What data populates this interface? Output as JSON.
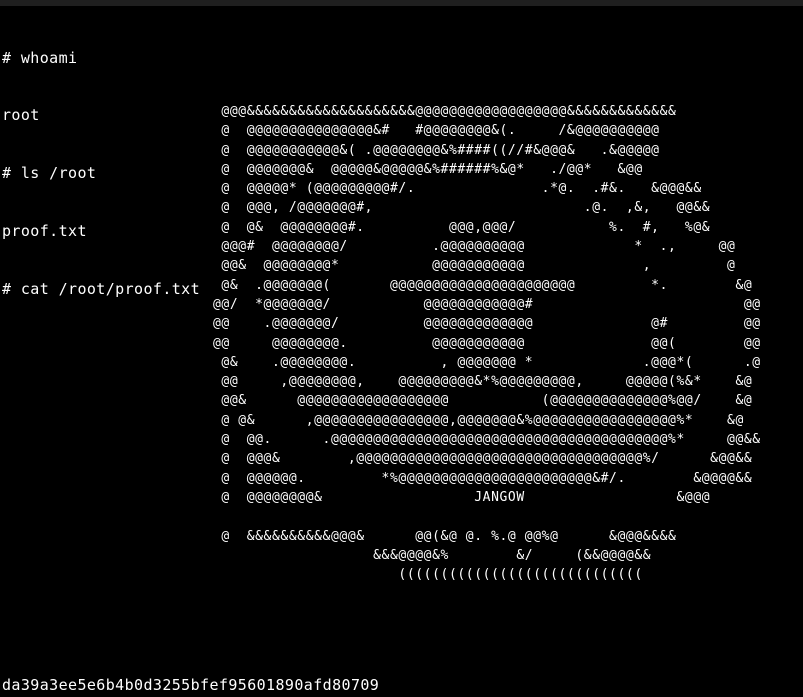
{
  "terminal": {
    "lines": [
      "# whoami",
      "root",
      "# ls /root",
      "proof.txt",
      "# cat /root/proof.txt"
    ],
    "ascii_art": [
      " @@@&&&&&&&&&&&&&&&&&&&&@@@@@@@@@@@@@@@@@@&&&&&&&&&&&&&",
      " @  @@@@@@@@@@@@@@@&#   #@@@@@@@@&(.     /&@@@@@@@@@@",
      " @  @@@@@@@@@@@&( .@@@@@@@@&%####((//#&@@@&   .&@@@@@",
      " @  @@@@@@@&  @@@@@&@@@@@&%######%&@*   ./@@*   &@@",
      " @  @@@@@* (@@@@@@@@@#/.               .*@.  .#&.   &@@@&&",
      " @  @@@, /@@@@@@@#,                         .@.  ,&,   @@&&",
      " @  @&  @@@@@@@@#.          @@@,@@@/           %.  #,   %@&",
      " @@@#  @@@@@@@@/          .@@@@@@@@@@             *  .,     @@",
      " @@&  @@@@@@@@*           @@@@@@@@@@@              ,         @",
      " @&  .@@@@@@@(       @@@@@@@@@@@@@@@@@@@@@@         *.        &@",
      "@@/  *@@@@@@@/           @@@@@@@@@@@@#                         @@",
      "@@    .@@@@@@@/          @@@@@@@@@@@@@              @#         @@",
      "@@     @@@@@@@@.          @@@@@@@@@@@               @@(        @@",
      " @&    .@@@@@@@@.          , @@@@@@@ *             .@@@*(      .@",
      " @@     ,@@@@@@@@,    @@@@@@@@@&*%@@@@@@@@@,     @@@@@(%&*    &@",
      " @@&      @@@@@@@@@@@@@@@@@@           (@@@@@@@@@@@@@@%@@/    &@",
      " @ @&      ,@@@@@@@@@@@@@@@@,@@@@@@@&%@@@@@@@@@@@@@@@@@%*    &@",
      " @  @@.      .@@@@@@@@@@@@@@@@@@@@@@@@@@@@@@@@@@@@@@@@%*     @@&&",
      " @  @@@&        ,@@@@@@@@@@@@@@@@@@@@@@@@@@@@@@@@@@%/      &@@&&",
      " @  @@@@@@.         *%@@@@@@@@@@@@@@@@@@@@@@@&#/.        &@@@@&&",
      " @  @@@@@@@@&                  JANGOW                  &@@@",
      "",
      " @  &&&&&&&&&&@@@&      @@(&@ @. %.@ @@%@      &@@@&&&&",
      "                   &&&@@@@&%        &/     (&&@@@@&&",
      "                      ((((((((((((((((((((((((((((("
    ],
    "flag_hash": "da39a3ee5e6b4b0d3255bfef95601890afd80709",
    "colors": {
      "background": "#000000",
      "foreground": "#ffffff",
      "title_bar": "#1f1f1f"
    }
  }
}
